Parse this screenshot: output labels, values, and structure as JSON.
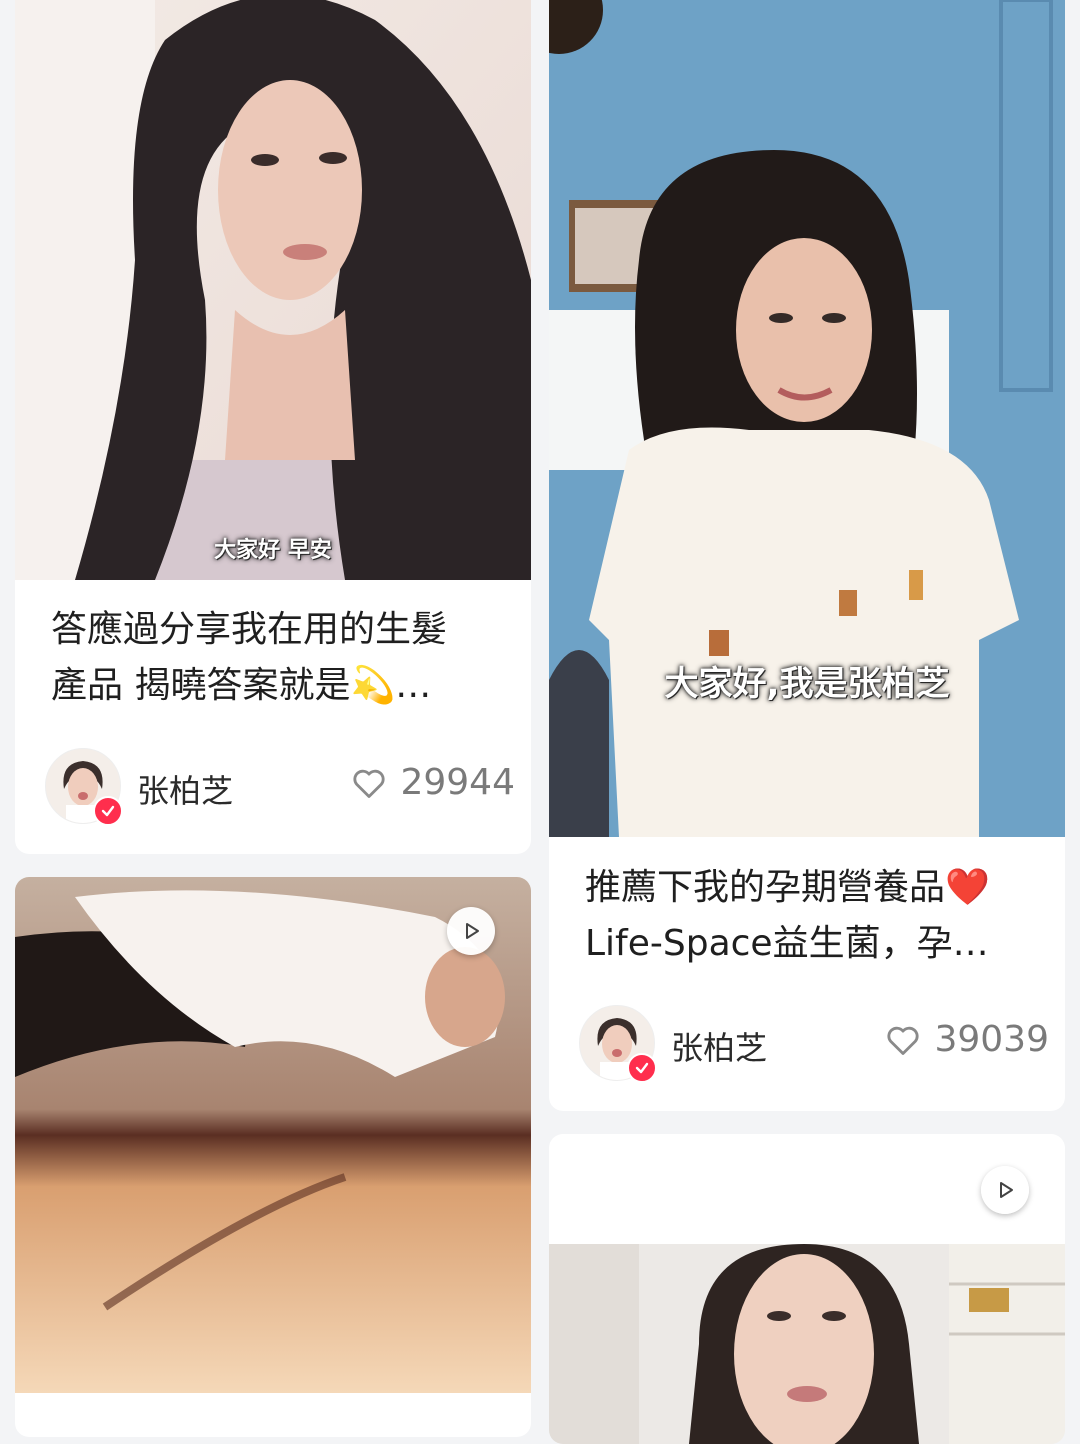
{
  "feed": {
    "cards": [
      {
        "caption": "大家好 早安",
        "title_lines": [
          "答應過分享我在用的生髮",
          "產品 揭曉答案就是💫…"
        ],
        "author": "张柏芝",
        "likes": "29944"
      },
      {
        "caption": "大家好,我是张柏芝",
        "title_lines": [
          "推薦下我的孕期營養品❤️",
          "Life-Space益生菌，孕…"
        ],
        "author": "张柏芝",
        "likes": "39039"
      }
    ]
  },
  "colors": {
    "background": "#f3f4f6",
    "card": "#ffffff",
    "verified_badge": "#ff2e4d",
    "like_text": "#7a7a7a"
  },
  "icons": [
    "play-icon",
    "heart-outline-icon",
    "verified-badge-icon"
  ]
}
